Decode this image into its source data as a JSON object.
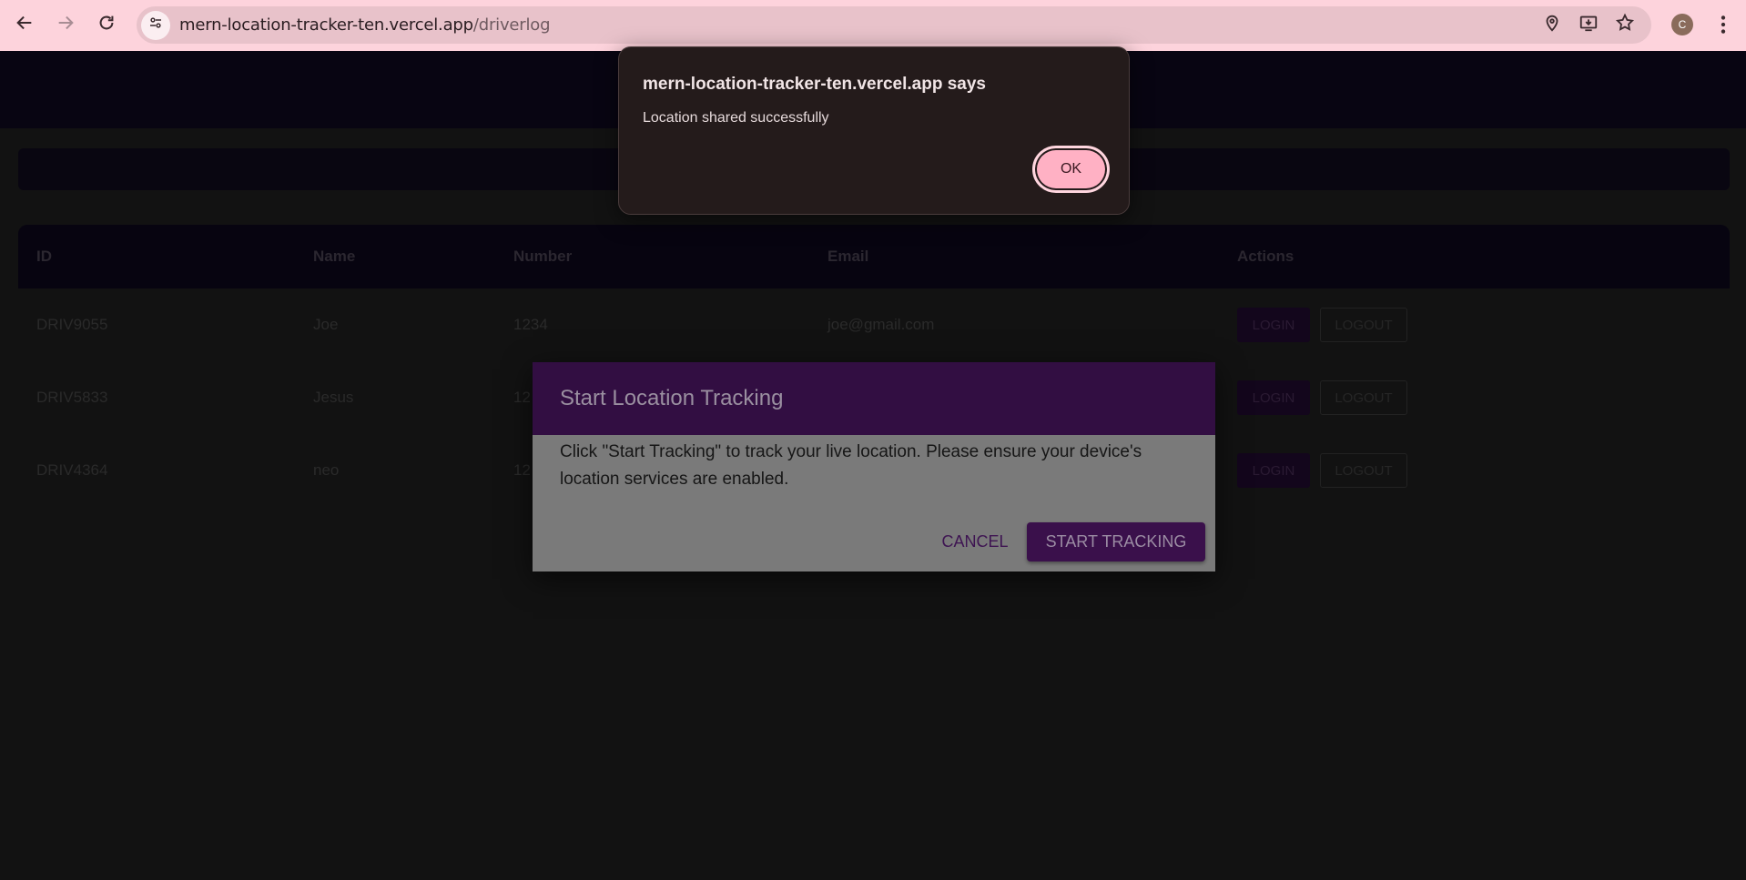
{
  "browser": {
    "url_host": "mern-location-tracker-ten.vercel.app",
    "url_path": "/driverlog",
    "profile_initial": "C"
  },
  "table": {
    "headers": [
      "ID",
      "Name",
      "Number",
      "Email",
      "Actions"
    ],
    "rows": [
      {
        "id": "DRIV9055",
        "name": "Joe",
        "number": "1234",
        "email": "joe@gmail.com",
        "login": "LOGIN",
        "logout": "LOGOUT"
      },
      {
        "id": "DRIV5833",
        "name": "Jesus",
        "number": "12",
        "email": "",
        "login": "LOGIN",
        "logout": "LOGOUT"
      },
      {
        "id": "DRIV4364",
        "name": "neo",
        "number": "12",
        "email": "",
        "login": "LOGIN",
        "logout": "LOGOUT"
      }
    ]
  },
  "tracking_dialog": {
    "title": "Start Location Tracking",
    "body": "Click \"Start Tracking\" to track your live location. Please ensure your device's location services are enabled.",
    "cancel_label": "CANCEL",
    "start_label": "START TRACKING"
  },
  "alert": {
    "title": "mern-location-tracker-ten.vercel.app says",
    "message": "Location shared successfully",
    "ok_label": "OK"
  },
  "colors": {
    "chrome": "#fdd3dc",
    "dialog_header": "#320e42",
    "alert_bg": "#241b1b",
    "alert_ok": "#ffb1c4"
  }
}
